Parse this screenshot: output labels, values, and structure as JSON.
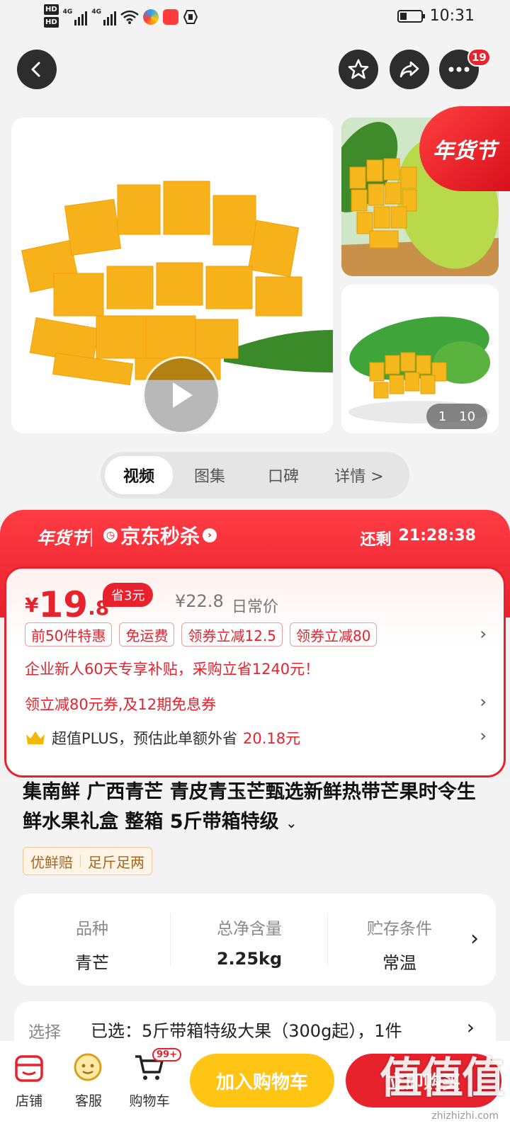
{
  "status_bar": {
    "time": "10:31",
    "hd1": "HD",
    "hd2": "HD",
    "net1": "4G",
    "net2": "4G"
  },
  "nav": {
    "badge_count": "19"
  },
  "gallery": {
    "festival_label": "年货节",
    "counter_current": "1",
    "counter_total": "10"
  },
  "tabs": [
    {
      "label": "视频"
    },
    {
      "label": "图集"
    },
    {
      "label": "口碑"
    },
    {
      "label": "详情 >"
    }
  ],
  "seckill": {
    "festival": "年货节",
    "brand": "京东秒杀",
    "remain_label": "还剩",
    "countdown": "21:28:38"
  },
  "price": {
    "yen": "¥",
    "integer": "19",
    "decimal": ".8",
    "save": "省3元",
    "original": "¥22.8",
    "original_label": "日常价"
  },
  "chips": [
    "前50件特惠",
    "免运费",
    "领券立减12.5",
    "领券立减80"
  ],
  "promo": {
    "subsidy": "企业新人60天专享补贴，采购立省1240元！",
    "coupon": "领立减80元券,及12期免息券",
    "plus_prefix": "超值PLUS，预估此单额外省",
    "plus_amount": "20.18元"
  },
  "product": {
    "title": "集南鲜   广西青芒 青皮青玉芒甄选新鲜热带芒果时令生鲜水果礼盒 整箱 5斤带箱特级",
    "tags": [
      "优鲜赔",
      "足斤足两"
    ]
  },
  "attrs": [
    {
      "key": "品种",
      "value": "青芒"
    },
    {
      "key": "总净含量",
      "value": "2.25kg"
    },
    {
      "key": "贮存条件",
      "value": "常温"
    }
  ],
  "select": {
    "label": "选择",
    "value": "已选：5斤带箱特级大果（300g起），1件"
  },
  "bottom": {
    "shop": "店铺",
    "service": "客服",
    "cart": "购物车",
    "cart_badge": "99+",
    "add_to_cart": "加入购物车",
    "buy_now": "立即购买"
  },
  "watermark": {
    "logo": "值值值",
    "url": "zhizhizhi.com"
  },
  "colors": {
    "accent": "#e8222d",
    "cart_button": "#ffc414"
  }
}
